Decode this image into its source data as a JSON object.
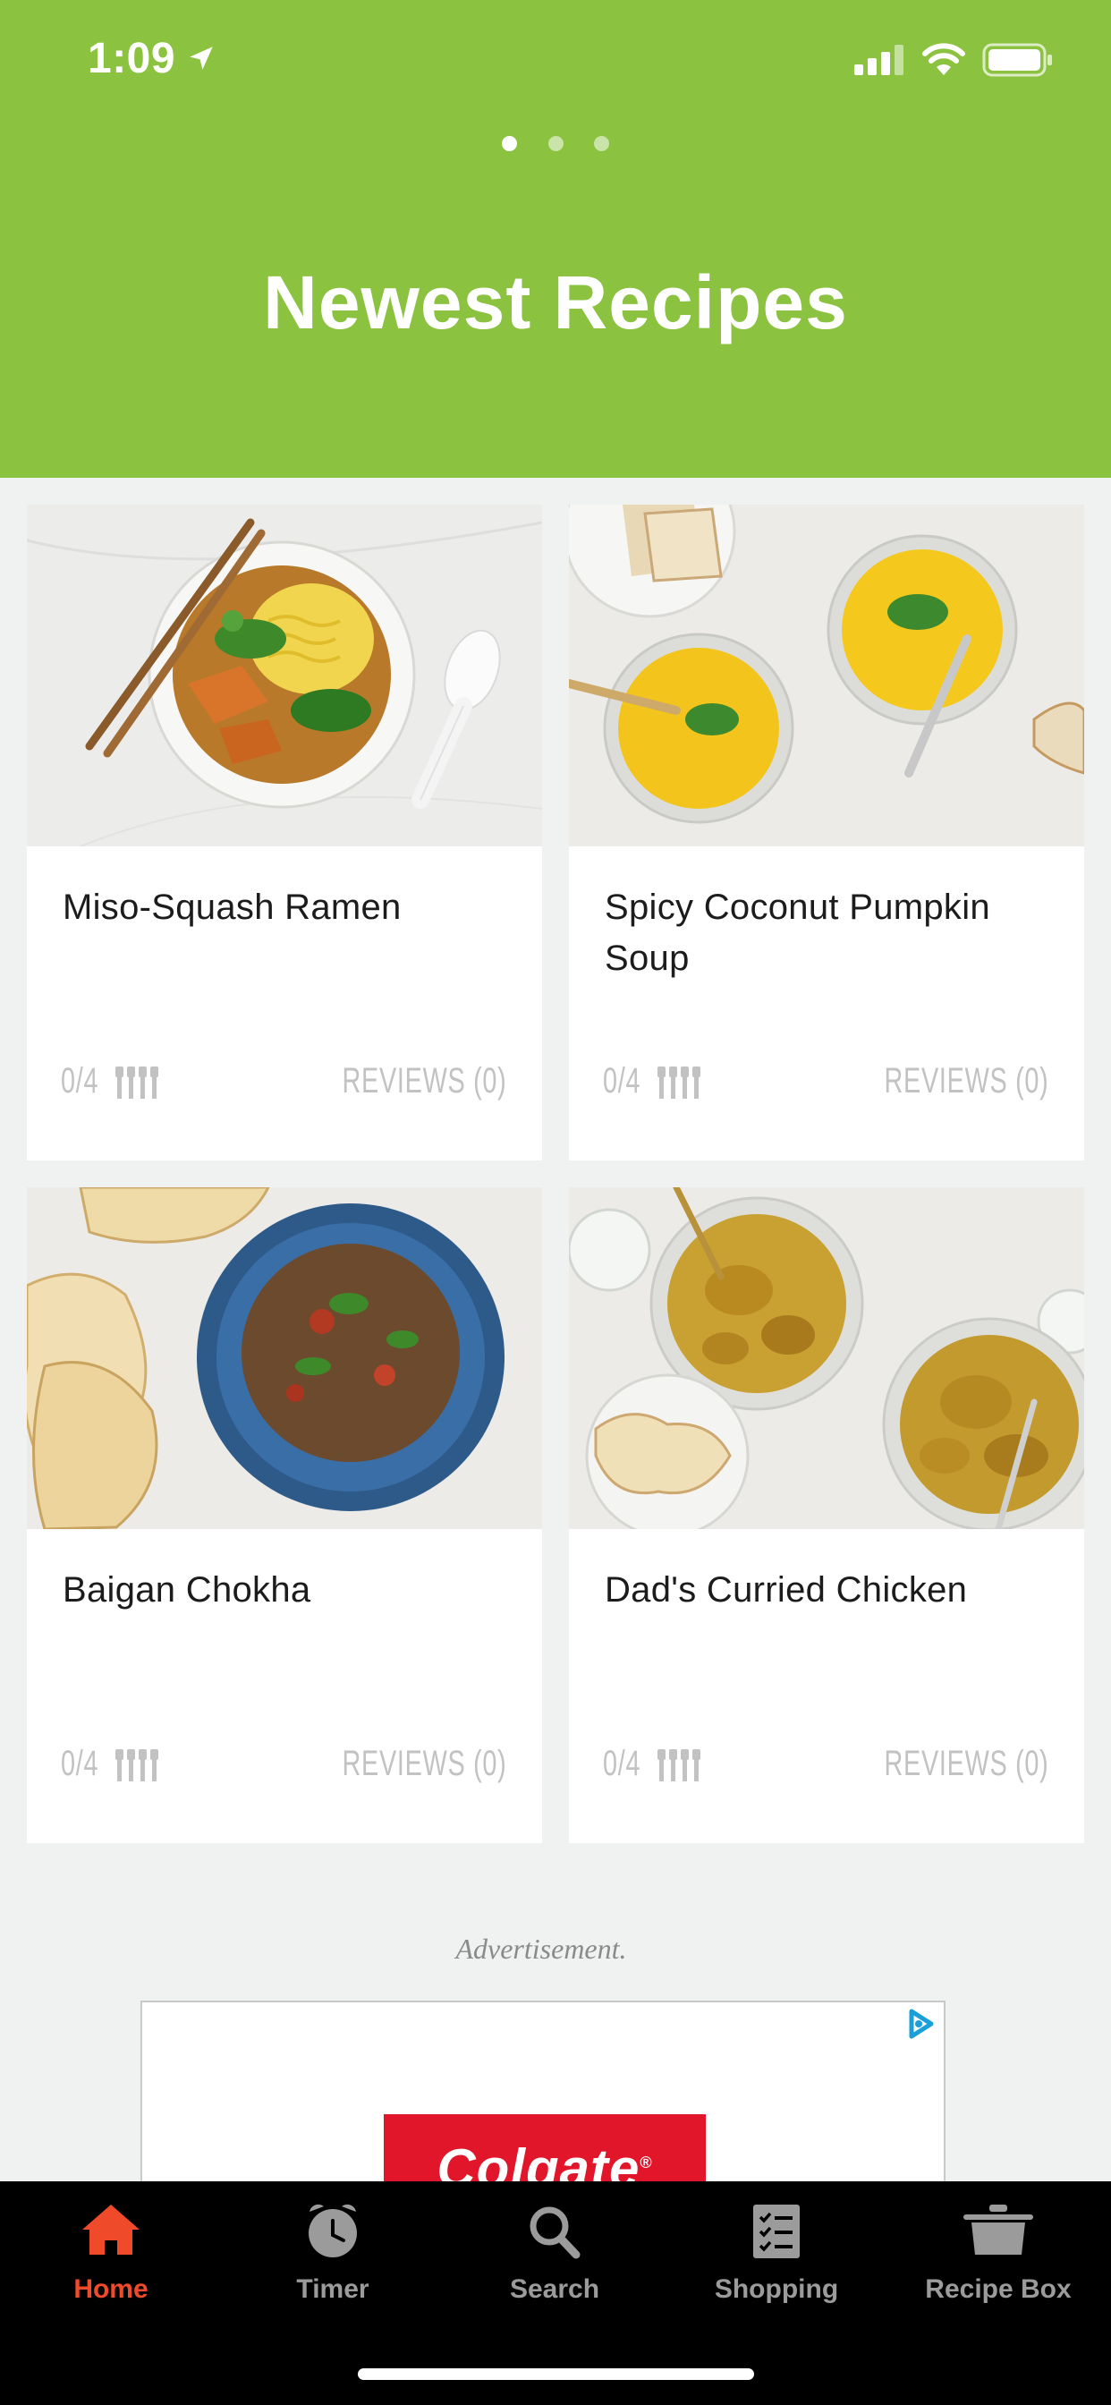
{
  "status": {
    "time": "1:09"
  },
  "header": {
    "title": "Newest Recipes",
    "pages": 3,
    "active_page": 0
  },
  "recipes": [
    {
      "title": "Miso-Squash Ramen",
      "rating": "0/4",
      "reviews": "REVIEWS (0)"
    },
    {
      "title": "Spicy Coconut Pumpkin Soup",
      "rating": "0/4",
      "reviews": "REVIEWS (0)"
    },
    {
      "title": "Baigan Chokha",
      "rating": "0/4",
      "reviews": "REVIEWS (0)"
    },
    {
      "title": "Dad's Curried Chicken",
      "rating": "0/4",
      "reviews": "REVIEWS (0)"
    }
  ],
  "ad": {
    "label": "Advertisement.",
    "brand": "Colgate"
  },
  "tabs": [
    {
      "label": "Home",
      "icon": "home-icon",
      "active": true
    },
    {
      "label": "Timer",
      "icon": "timer-icon",
      "active": false
    },
    {
      "label": "Search",
      "icon": "search-icon",
      "active": false
    },
    {
      "label": "Shopping",
      "icon": "shopping-list-icon",
      "active": false
    },
    {
      "label": "Recipe Box",
      "icon": "pot-icon",
      "active": false
    }
  ],
  "colors": {
    "header_bg": "#8bc23f",
    "active_tab": "#ef4a2a",
    "tab_bar_bg": "#000000"
  }
}
